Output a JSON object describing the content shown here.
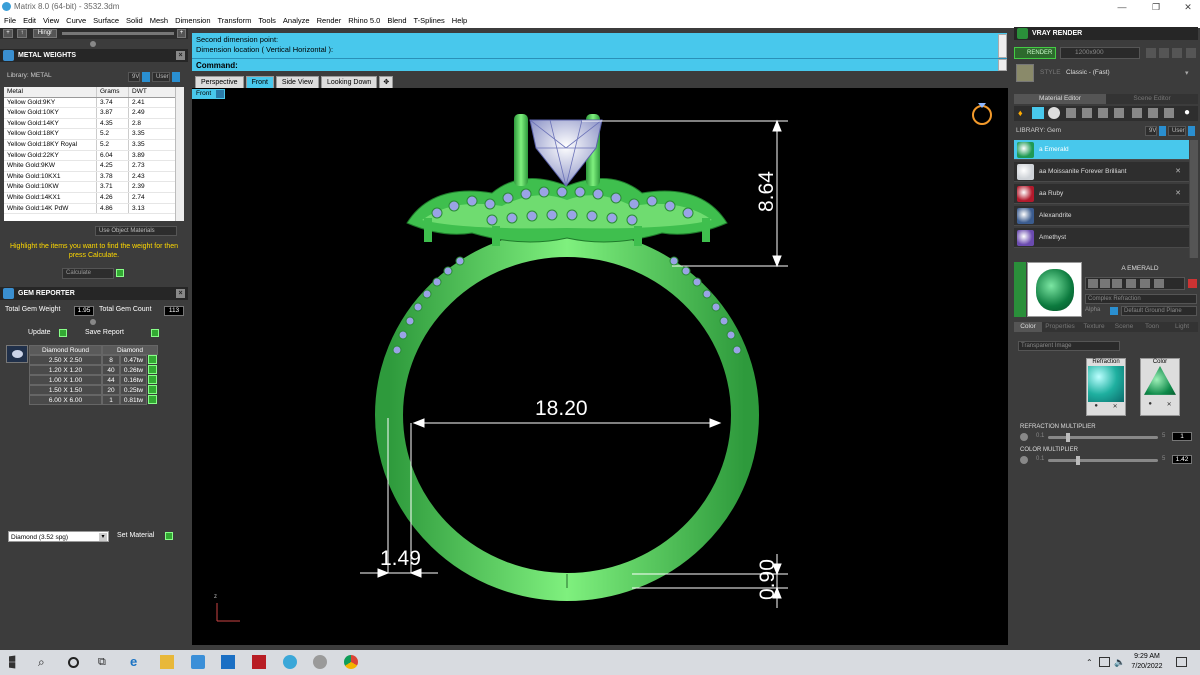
{
  "window": {
    "title": "Matrix 8.0 (64-bit) - 3532.3dm",
    "min": "—",
    "max": "❐",
    "close": "✕"
  },
  "menu": [
    "File",
    "Edit",
    "View",
    "Curve",
    "Surface",
    "Solid",
    "Mesh",
    "Dimension",
    "Transform",
    "Tools",
    "Analyze",
    "Render",
    "Rhino 5.0",
    "Blend",
    "T-Splines",
    "Help"
  ],
  "toolstrip": {
    "hinge_label": "Hingr"
  },
  "metal_weights": {
    "title": "METAL WEIGHTS",
    "library": "Library: METAL",
    "filter_9v": "9V",
    "filter_user": "User",
    "columns": [
      "Metal",
      "Grams",
      "DWT"
    ],
    "rows": [
      [
        "Yellow Gold:9KY",
        "3.74",
        "2.41"
      ],
      [
        "Yellow Gold:10KY",
        "3.87",
        "2.49"
      ],
      [
        "Yellow Gold:14KY",
        "4.35",
        "2.8"
      ],
      [
        "Yellow Gold:18KY",
        "5.2",
        "3.35"
      ],
      [
        "Yellow Gold:18KY Royal",
        "5.2",
        "3.35"
      ],
      [
        "Yellow Gold:22KY",
        "6.04",
        "3.89"
      ],
      [
        "White Gold:9KW",
        "4.25",
        "2.73"
      ],
      [
        "White Gold:10KX1",
        "3.78",
        "2.43"
      ],
      [
        "White Gold:10KW",
        "3.71",
        "2.39"
      ],
      [
        "White Gold:14KX1",
        "4.26",
        "2.74"
      ],
      [
        "White Gold:14K PdW",
        "4.86",
        "3.13"
      ]
    ],
    "use_object_materials": "Use Object Materials",
    "hint": "Highlight the items you want to find the weight for then press Calculate.",
    "calculate": "Calculate"
  },
  "gem_reporter": {
    "title": "GEM REPORTER",
    "total_weight_label": "Total Gem Weight",
    "total_weight": "1.95",
    "total_count_label": "Total Gem Count",
    "total_count": "113",
    "update": "Update",
    "save_report": "Save Report",
    "headers": [
      "Diamond Round",
      "Diamond"
    ],
    "rows": [
      [
        "2.50 X 2.50",
        "8",
        "0.47tw"
      ],
      [
        "1.20 X 1.20",
        "40",
        "0.26tw"
      ],
      [
        "1.00 X 1.00",
        "44",
        "0.16tw"
      ],
      [
        "1.50 X 1.50",
        "20",
        "0.25tw"
      ],
      [
        "6.00 X 6.00",
        "1",
        "0.81tw"
      ]
    ],
    "material_select": "Diamond     (3.52 spg)",
    "set_material": "Set Material"
  },
  "command": {
    "line1": "Second dimension point:",
    "line2": "Dimension location ( Vertical  Horizontal ):",
    "prompt": "Command:"
  },
  "viewport": {
    "tabs": [
      "Perspective",
      "Front",
      "Side View",
      "Looking Down"
    ],
    "active_tab": "Front",
    "view_label": "Front",
    "dimensions": {
      "height": "8.64",
      "inner_diameter": "18.20",
      "band_width": "1.49",
      "thickness": "0.90"
    },
    "axis_label": "z"
  },
  "vray": {
    "title": "VRAY RENDER",
    "render_btn": "RENDER",
    "resolution": "1200x900",
    "style_label": "STYLE",
    "style_value": "Classic - (Fast)",
    "tabs": [
      "Material Editor",
      "Scene Editor"
    ],
    "library": "LIBRARY: Gem",
    "filter_9v": "9V",
    "filter_user": "User",
    "materials": [
      {
        "name": "a Emerald",
        "color": "#1f9a55"
      },
      {
        "name": "aa Moissanite Forever Brilliant",
        "color": "#cfd3d8"
      },
      {
        "name": "aa Ruby",
        "color": "#b21a2c"
      },
      {
        "name": "Alexandrite",
        "color": "#3b5c8f"
      },
      {
        "name": "Amethyst",
        "color": "#6b4bb0"
      }
    ],
    "active_material": "a Emerald",
    "preview_title": "A EMERALD",
    "refraction_type": "Complex Refraction",
    "alpha_label": "Alpha",
    "ground_plane": "Default Ground Plane",
    "prop_tabs": [
      "Color",
      "Properties",
      "Texture",
      "Scene",
      "Toon",
      "Light"
    ],
    "transparent": "Transparent Image",
    "refraction_label": "Refraction",
    "color_label": "Color",
    "refraction_mult_label": "REFRACTION MULTIPLIER",
    "refraction_min": "0.1",
    "refraction_max": "5",
    "refraction_value": "1",
    "color_mult_label": "COLOR MULTIPLIER",
    "color_min": "0.1",
    "color_max": "5",
    "color_value": "1.42"
  },
  "taskbar": {
    "time": "9:29 AM",
    "date": "7/20/2022"
  }
}
